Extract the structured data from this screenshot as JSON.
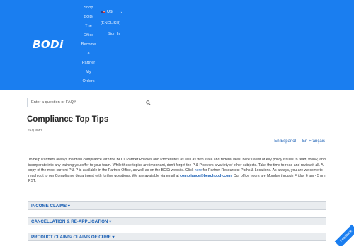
{
  "header": {
    "logo": "BODi",
    "nav_items": [
      "Shop",
      "BODi",
      "The",
      "Office",
      "Become",
      "a",
      "Partner",
      "My",
      "Orders"
    ],
    "lang_code": "US",
    "lang_name": "(ENGLISH)",
    "sign_in": "Sign In",
    "brand_color": "#1a7ef0"
  },
  "search": {
    "placeholder": "Enter a question or FAQ#",
    "icon": "search-icon"
  },
  "article": {
    "title": "Compliance Top Tips",
    "faq_id": "FAQ 4057",
    "lang_es": "En Español",
    "lang_fr": "En Français",
    "body_1": "To help Partners always maintain compliance with the BODi Partner Policies and Procedures as well as with state and federal laws, here’s a list of key policy issues to read, follow, and incorporate into any training you offer to your team. While these topics are important, don’t forget the P & P covers a variety of other subjects. Take the time to read and review it all. A copy of the most current P & P is available in the Partner Office, as well as on the BODi website. Click ",
    "link_here": "here",
    "body_2": " for Partner Resources: Paths & Locations. As always, you are welcome to reach out to our Compliance department with further questions. We are available via email at ",
    "email": "compliance@beachbody.com",
    "body_3": ". Our office hours are Monday through Friday 6 am - 5 pm PST."
  },
  "sections": [
    "INCOME CLAIMS ▾",
    "CANCELLATION & RE-APPLICATION ▾",
    "PRODUCT CLAIMS/ CLAIMS OF CURE ▾"
  ],
  "feedback_label": "Feedback"
}
